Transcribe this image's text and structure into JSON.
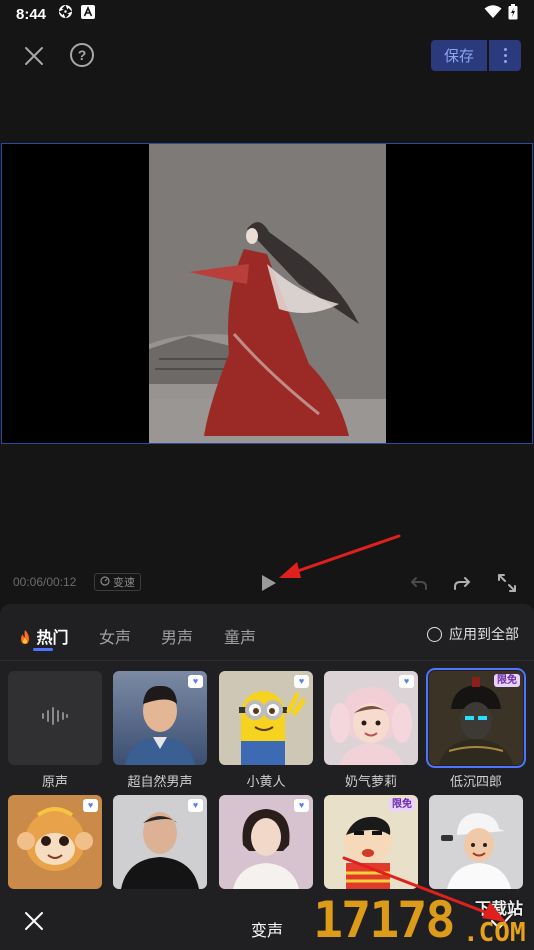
{
  "status_bar": {
    "time": "8:44"
  },
  "topbar": {
    "save_label": "保存"
  },
  "timeline": {
    "timecode": "00:06/00:12",
    "speed_label": "变速"
  },
  "tabs": [
    {
      "label": "热门",
      "icon": "fire-icon",
      "active": true
    },
    {
      "label": "女声",
      "active": false
    },
    {
      "label": "男声",
      "active": false
    },
    {
      "label": "童声",
      "active": false
    }
  ],
  "apply_all_label": "应用到全部",
  "voices_row1": [
    {
      "label": "原声",
      "icon": "waveform-icon"
    },
    {
      "label": "超自然男声",
      "favorite": true
    },
    {
      "label": "小黄人",
      "favorite": true
    },
    {
      "label": "奶气萝莉",
      "favorite": true
    },
    {
      "label": "低沉四郎",
      "badge": "限免",
      "selected": true
    }
  ],
  "voices_row2": [
    {
      "favorite": true
    },
    {
      "favorite": true
    },
    {
      "favorite": true
    },
    {
      "badge": "限免"
    },
    {
      "favorite": false
    }
  ],
  "bottom_bar": {
    "title": "变声"
  },
  "watermark": {
    "site_text": "下载站",
    "brand": "17178",
    "domain_suffix": ".COM"
  },
  "colors": {
    "accent": "#4f74ff",
    "panel_bg": "#202022",
    "annotation_red": "#e0201c",
    "watermark_orange": "#e8a21a"
  }
}
